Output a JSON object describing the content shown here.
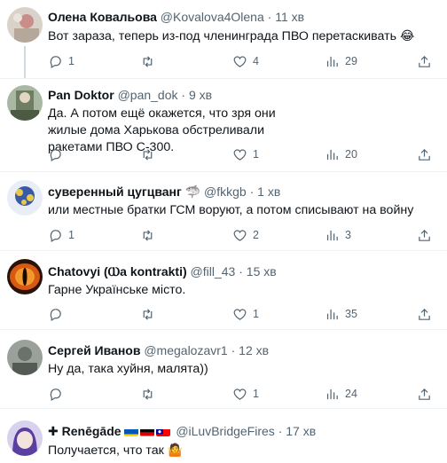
{
  "replies": [
    {
      "name": "Олена Ковальова",
      "handle": "@Kovalova4Olena",
      "time": "11 хв",
      "text": "Вот зараза, теперь из-под членинграда ПВО перетаскивать",
      "emoji": "😂",
      "stats": {
        "reply": "1",
        "retweet": "",
        "like": "4",
        "views": "29"
      }
    },
    {
      "name": "Pan Doktor",
      "handle": "@pan_dok",
      "time": "9 хв",
      "text": "Да. А потом ещё окажется, что зря они жилые дома Харькова обстреливали ракетами ПВО С-300.",
      "stats": {
        "reply": "",
        "retweet": "",
        "like": "1",
        "views": "20"
      }
    },
    {
      "name": "суверенный цугцванг",
      "name_emoji": "🦈",
      "handle": "@fkkgb",
      "time": "1 хв",
      "text": "или местные братки ГСМ воруют, а потом списывают на войну",
      "stats": {
        "reply": "1",
        "retweet": "",
        "like": "2",
        "views": "3"
      }
    },
    {
      "name": "Chatovyi (Ⲱa kontrakti)",
      "handle": "@fill_43",
      "time": "15 хв",
      "text": "Гарне Українське місто.",
      "stats": {
        "reply": "",
        "retweet": "",
        "like": "1",
        "views": "35"
      }
    },
    {
      "name": "Сергей Иванов",
      "handle": "@megalozavr1",
      "time": "12 хв",
      "text": "Ну да, така хуйня, малята))",
      "stats": {
        "reply": "",
        "retweet": "",
        "like": "1",
        "views": "24"
      }
    },
    {
      "name": "✚ Renēgāde",
      "handle": "@iLuvBridgeFires",
      "time": "17 хв",
      "text": "Получается, что так",
      "emoji": "🤷",
      "stats": {
        "reply": "",
        "retweet": "",
        "like": "",
        "views": ""
      }
    }
  ],
  "dot": "·",
  "colors": {
    "text": "#0f1419",
    "secondary": "#536471",
    "divider": "#eff3f4",
    "thread": "#cfd9de"
  }
}
